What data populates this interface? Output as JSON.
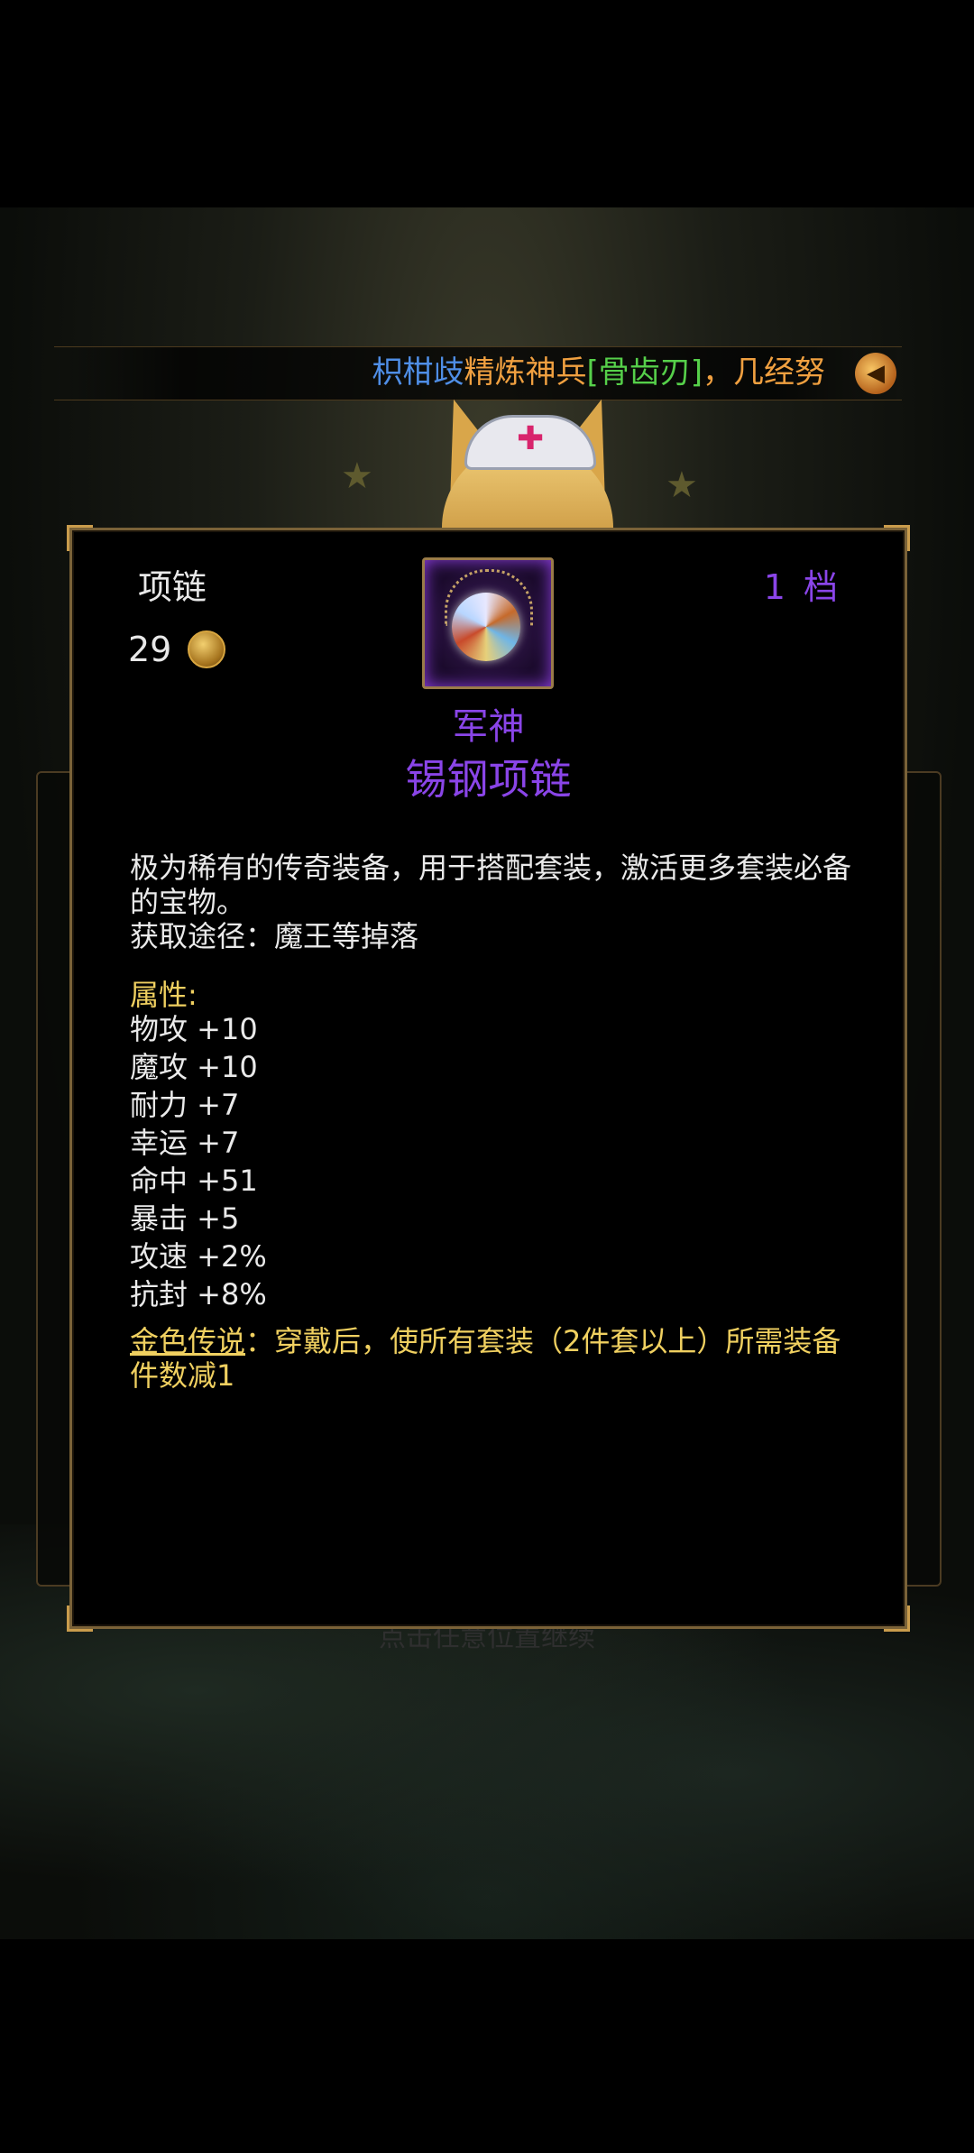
{
  "ticker": {
    "player": "枳柑歧",
    "action": "精炼神兵",
    "item": "[骨齿刃]",
    "rest": "，几经努"
  },
  "item": {
    "type": "项链",
    "price": "29",
    "tier": "1 档",
    "set_name": "军神",
    "name": "锡钢项链",
    "description": "极为稀有的传奇装备，用于搭配套装，激活更多套装必备的宝物。",
    "source": "获取途径：魔王等掉落",
    "attr_title": "属性:",
    "attributes": [
      "物攻 +10",
      "魔攻 +10",
      "耐力 +7",
      "幸运 +7",
      "命中 +51",
      "暴击 +5",
      "攻速 +2%",
      "抗封 +8%"
    ],
    "legend_label": "金色传说",
    "legend_text": "：穿戴后，使所有套装（2件套以上）所需装备件数减1"
  },
  "hint": "点击任意位置继续",
  "colors": {
    "rarity": "#8a45e8",
    "gold_text": "#f0d060",
    "border": "#7a6238"
  }
}
